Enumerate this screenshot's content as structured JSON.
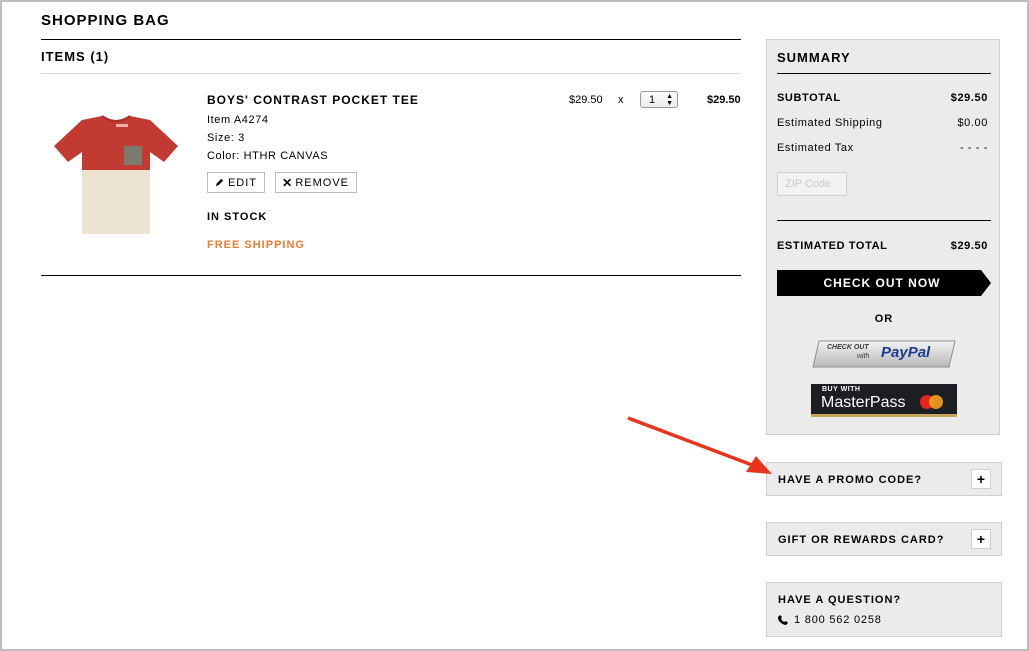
{
  "page": {
    "title": "SHOPPING BAG",
    "items_heading": "ITEMS (1)"
  },
  "cart": {
    "items": [
      {
        "name": "BOYS' CONTRAST POCKET TEE",
        "item_no": "Item A4274",
        "size": "Size: 3",
        "color": "Color: HTHR CANVAS",
        "edit_label": "EDIT",
        "remove_label": "REMOVE",
        "stock": "IN STOCK",
        "shipping": "FREE SHIPPING",
        "unit_price": "$29.50",
        "times": "x",
        "quantity": "1",
        "line_total": "$29.50"
      }
    ]
  },
  "summary": {
    "title": "SUMMARY",
    "subtotal_label": "SUBTOTAL",
    "subtotal_value": "$29.50",
    "shipping_label": "Estimated Shipping",
    "shipping_value": "$0.00",
    "tax_label": "Estimated Tax",
    "tax_value": "- - - -",
    "zip_placeholder": "ZIP Code",
    "total_label": "ESTIMATED TOTAL",
    "total_value": "$29.50",
    "checkout_label": "CHECK OUT NOW",
    "or_label": "OR",
    "paypal_top": "CHECK OUT",
    "paypal_with": "with",
    "paypal_brand": "PayPal",
    "masterpass_top": "BUY WITH",
    "masterpass_brand": "MasterPass"
  },
  "promo": {
    "label": "HAVE A PROMO CODE?",
    "toggle": "+"
  },
  "gift": {
    "label": "GIFT OR REWARDS CARD?",
    "toggle": "+"
  },
  "help": {
    "label": "HAVE A QUESTION?",
    "phone": "1 800 562 0258"
  },
  "colors": {
    "accent_orange": "#e87a34",
    "panel_gray": "#ebebeb",
    "annotation_arrow": "#e8341c"
  }
}
